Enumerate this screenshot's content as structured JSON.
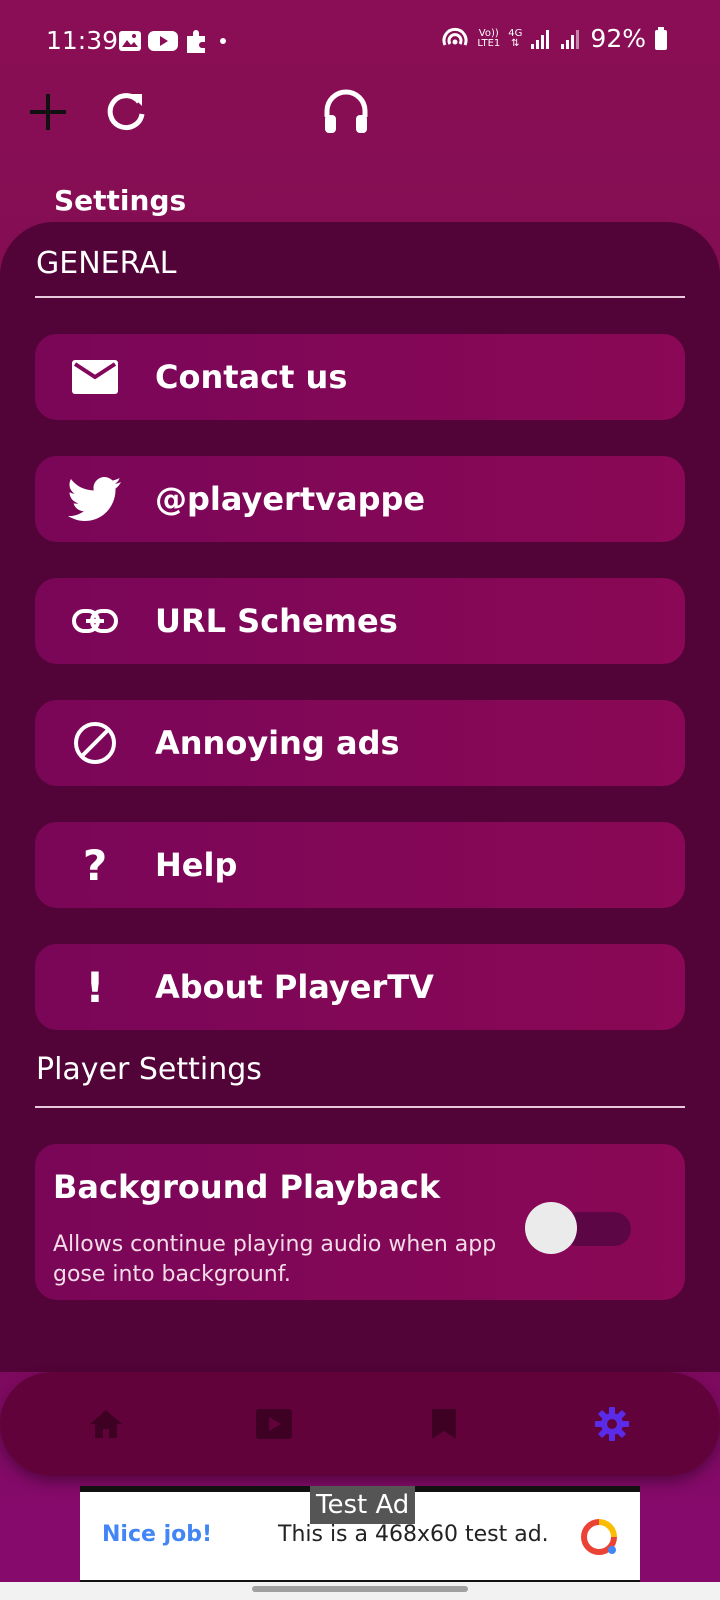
{
  "status_bar": {
    "time": "11:39",
    "network_volte": "Vo))",
    "network_lte": "LTE1",
    "network_4g": "4G",
    "battery": "92%"
  },
  "toolbar": {
    "add_icon": "plus-icon",
    "refresh_icon": "refresh-icon",
    "headphones_icon": "headphones-icon"
  },
  "page_title": "Settings",
  "general": {
    "header": "GENERAL",
    "items": [
      {
        "label": "Contact us",
        "icon": "mail-icon"
      },
      {
        "label": "@playertvappe",
        "icon": "twitter-icon"
      },
      {
        "label": "URL Schemes",
        "icon": "link-icon"
      },
      {
        "label": "Annoying ads",
        "icon": "block-icon"
      },
      {
        "label": "Help",
        "icon": "question-icon"
      },
      {
        "label": "About PlayerTV",
        "icon": "exclamation-icon"
      }
    ]
  },
  "player_settings": {
    "header": "Player Settings",
    "background_playback": {
      "title": "Background Playback",
      "description": "Allows continue playing audio when app gose into backgrounf.",
      "enabled": false
    }
  },
  "bottom_nav": {
    "items": [
      "home-icon",
      "video-icon",
      "bookmark-icon",
      "settings-icon"
    ],
    "active": "settings-icon",
    "active_color": "#5a2be8",
    "inactive_color": "#3e0124"
  },
  "ad": {
    "badge": "Test Ad",
    "left_text": "Nice job!",
    "body_text": "This is a 468x60 test ad."
  },
  "colors": {
    "background": "#8a0e55",
    "panel": "#520338",
    "card": "#82075a"
  }
}
